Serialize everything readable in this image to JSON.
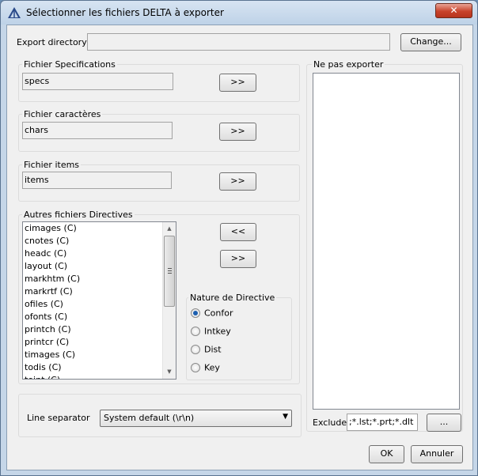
{
  "window": {
    "title": "Sélectionner les fichiers DELTA à exporter",
    "close_label": "✕"
  },
  "export": {
    "label": "Export directory:",
    "value": "",
    "change_button": "Change..."
  },
  "spec_group": {
    "title": "Fichier Specifications",
    "value": "specs",
    "move_button": ">>"
  },
  "chars_group": {
    "title": "Fichier caractères",
    "value": "chars",
    "move_button": ">>"
  },
  "items_group": {
    "title": "Fichier items",
    "value": "items",
    "move_button": ">>"
  },
  "directives": {
    "title": "Autres fichiers Directives",
    "items": [
      "cimages (C)",
      "cnotes (C)",
      "headc (C)",
      "layout (C)",
      "markhtm (C)",
      "markrtf (C)",
      "ofiles (C)",
      "ofonts (C)",
      "printch (C)",
      "printcr (C)",
      "timages (C)",
      "todis (C)",
      "toint (C)"
    ],
    "move_left_button": "<<",
    "move_right_button": ">>"
  },
  "nature": {
    "title": "Nature de Directive",
    "options": [
      {
        "label": "Confor",
        "selected": true
      },
      {
        "label": "Intkey",
        "selected": false
      },
      {
        "label": "Dist",
        "selected": false
      },
      {
        "label": "Key",
        "selected": false
      }
    ]
  },
  "line_separator": {
    "label": "Line separator",
    "value": "System default (\\r\\n)"
  },
  "ne_pas_exporter": {
    "title": "Ne pas exporter",
    "items": []
  },
  "exclude": {
    "label": "Exclude",
    "value": ";*.lst;*.prt;*.dlt",
    "browse_button": "..."
  },
  "footer": {
    "ok_button": "OK",
    "cancel_button": "Annuler"
  }
}
